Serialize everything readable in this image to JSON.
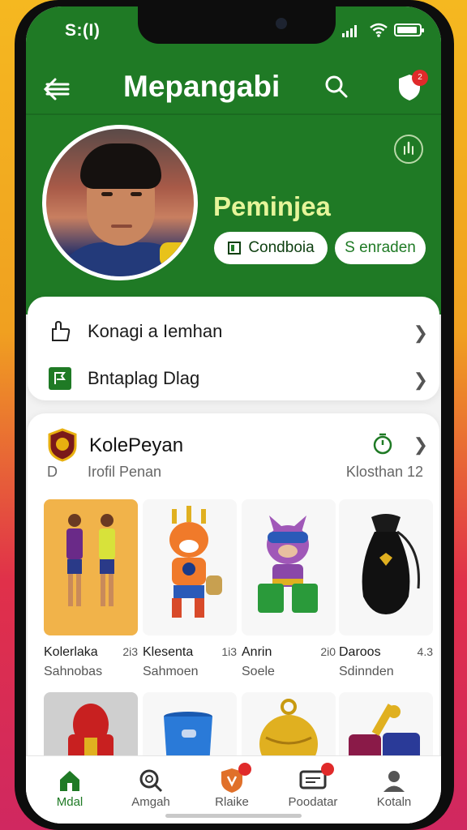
{
  "status": {
    "time": "S:(I)"
  },
  "appbar": {
    "title": "Mepangabi",
    "badge": "2"
  },
  "profile": {
    "name": "Peminjea",
    "buttons": [
      {
        "label": "Condboia",
        "icon": "doc-icon"
      },
      {
        "label": "S enraden"
      }
    ]
  },
  "menu": [
    {
      "label": "Konagi a Iemhan",
      "icon": "share-icon"
    },
    {
      "label": "Bntaplag Dlag",
      "icon": "flag-icon"
    }
  ],
  "collection": {
    "title": "KolePeyan",
    "sub_left": "D",
    "sub_mid": "Irofil Penan",
    "sub_right": "Klosthan 12",
    "items": [
      {
        "name": "Kolerlaka",
        "count": "2i3",
        "sub": "Sahnobas"
      },
      {
        "name": "Klesenta",
        "count": "1i3",
        "sub": "Sahmoen"
      },
      {
        "name": "Anrin",
        "count": "2i0",
        "sub": "Soele"
      },
      {
        "name": "Daroos",
        "count": "4.3",
        "sub": "Sdinnden"
      }
    ]
  },
  "tabs": [
    {
      "label": "Mdal",
      "active": true
    },
    {
      "label": "Amgah"
    },
    {
      "label": "Rlaike"
    },
    {
      "label": "Poodatar"
    },
    {
      "label": "Kotaln"
    }
  ],
  "colors": {
    "primary": "#1f7a25",
    "accent_name": "#e6f59a",
    "badge": "#e02a2a"
  }
}
